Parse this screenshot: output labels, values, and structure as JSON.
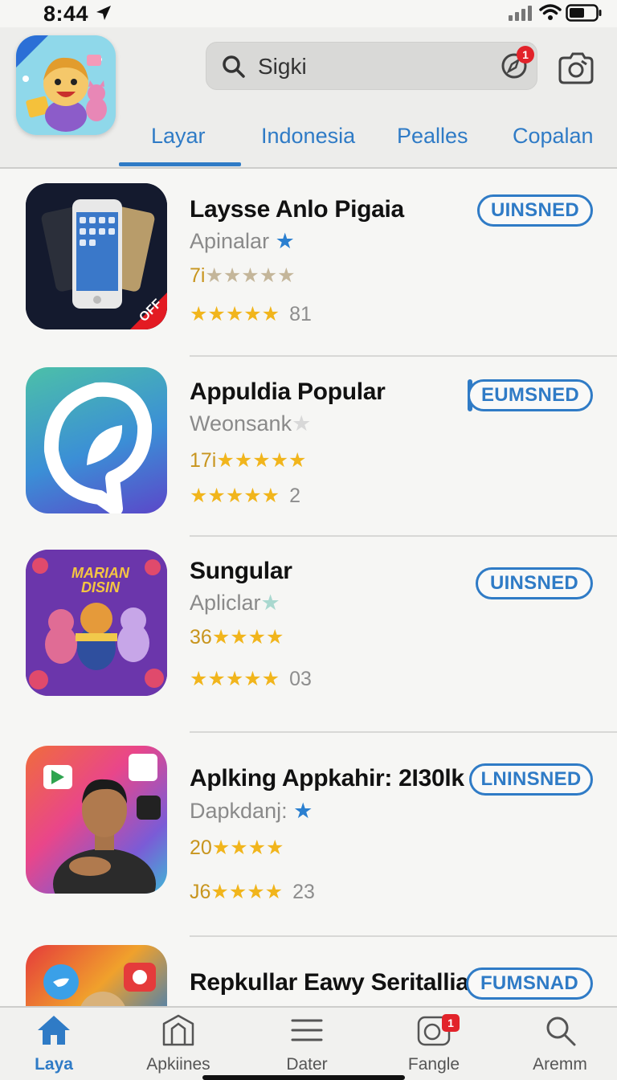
{
  "status": {
    "time": "8:44"
  },
  "search": {
    "query": "Sigki",
    "badge": "1"
  },
  "tabs": [
    "Layar",
    "Indonesia",
    "Pealles",
    "Copalan"
  ],
  "apps": [
    {
      "name": "Laysse Anlo Pigaia",
      "sub": "Apinalar",
      "sub_star": "★",
      "line1_prefix": "7i",
      "line1_stars": "★★★★★",
      "line2_stars": "★★★★★",
      "line2_count": "81",
      "button": "UINSNED"
    },
    {
      "name": "Appuldia Popular",
      "sub": "Weonsank",
      "sub_star": "★",
      "line1_prefix": "17i",
      "line1_stars": "★★★★★",
      "line2_stars": "★★★★★",
      "line2_count": "2",
      "button": "EUMSNED"
    },
    {
      "name": "Sungular",
      "sub": "Apliclar",
      "sub_star": "★",
      "line1_prefix": "36",
      "line1_stars": "★★★★",
      "line2_stars": "★★★★★",
      "line2_count": "03",
      "button": "UINSNED"
    },
    {
      "name": "Aplking Appkahir: 2I30lk",
      "sub": "Dapkdanj:",
      "sub_star": "★",
      "line1_prefix": "20",
      "line1_stars": "★★★★",
      "line2_prefix": "J6",
      "line2_stars": "★★★★",
      "line2_count": "23",
      "button": "LNINSNED"
    },
    {
      "name": "Repkullar Eawy Seritallia:",
      "sub": "",
      "sub_star": "",
      "button": "FUMSNAD"
    }
  ],
  "icon_texts": {
    "app3_title": "MARIAN DISIN",
    "app1_corner": "OFF"
  },
  "tabbar": [
    {
      "label": "Laya",
      "icon": "home-icon"
    },
    {
      "label": "Apkiines",
      "icon": "apps-icon"
    },
    {
      "label": "Dater",
      "icon": "list-icon"
    },
    {
      "label": "Fangle",
      "icon": "camera-square-icon",
      "badge": "1"
    },
    {
      "label": "Aremm",
      "icon": "search-icon"
    }
  ],
  "colors": {
    "accent": "#2f7bc6",
    "badge": "#e2232a",
    "star": "#f1b51c"
  }
}
